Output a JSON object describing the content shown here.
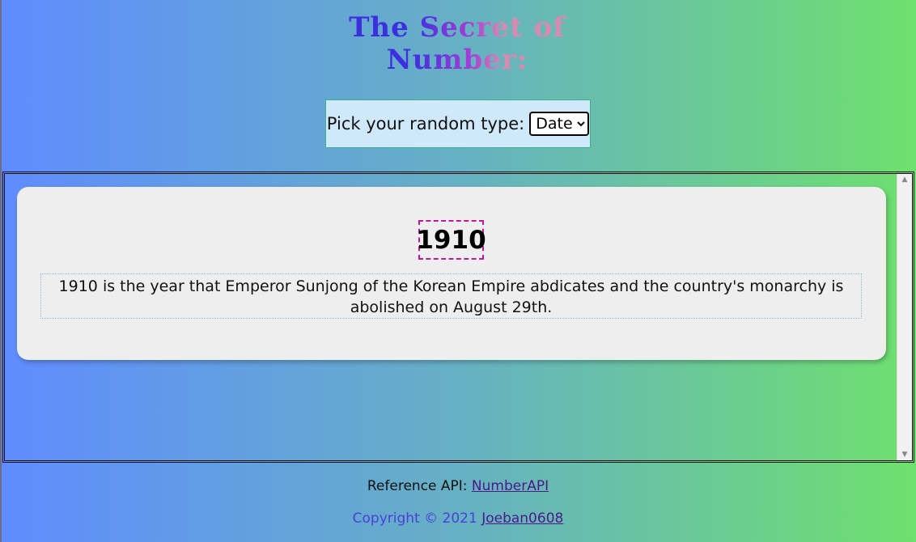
{
  "header": {
    "title": "The Secret of Number:"
  },
  "picker": {
    "label": "Pick your random type:",
    "selected": "Date"
  },
  "fact": {
    "number": "1910",
    "text": "1910 is the year that Emperor Sunjong of the Korean Empire abdicates and the country's monarchy is abolished on August 29th."
  },
  "footer": {
    "ref_label": "Reference API:",
    "ref_link": "NumberAPI",
    "copyright": "Copyright © 2021",
    "author_link": "Joeban0608"
  },
  "colors": {
    "card": "#eeeeee",
    "picker_bg": "#cfe9fb",
    "number_border": "#c0179a"
  }
}
